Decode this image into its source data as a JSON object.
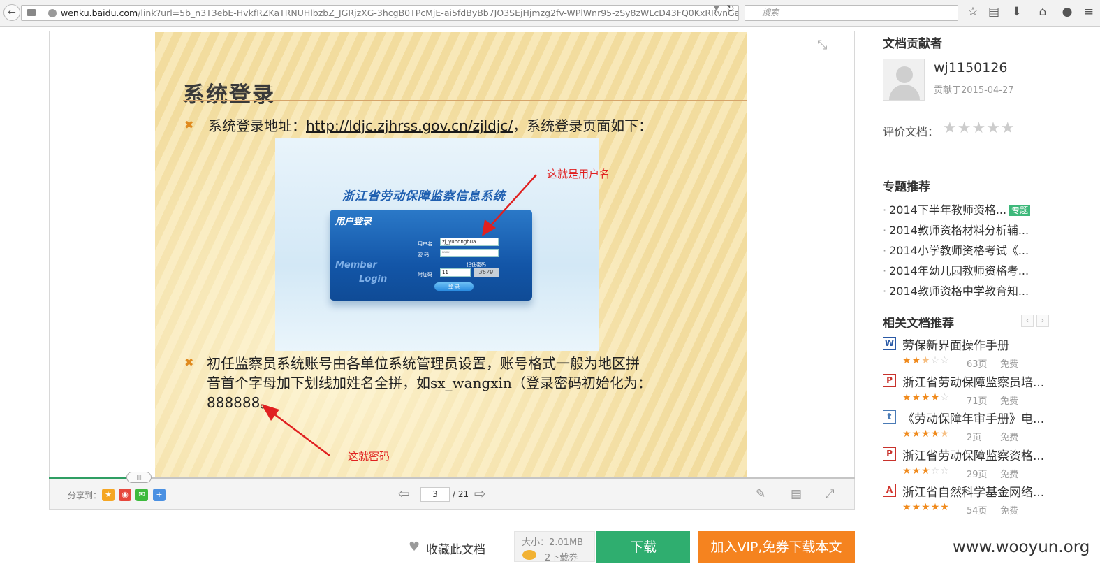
{
  "browser": {
    "url_host": "wenku.baidu.com",
    "url_rest": "/link?url=5b_n3T3ebE-HvkfRZKaTRNUHlbzbZ_JGRjzXG-3hcgB0TPcMjE-ai5fdByBb7JO3SEjHjmzg2fv-WPlWnr95-zSy8zWLcD43FQ0KxRRvnGa",
    "search_placeholder": "搜索",
    "icons": [
      "star-icon",
      "reading-list-icon",
      "download-icon",
      "home-icon",
      "chat-icon"
    ]
  },
  "slide": {
    "title": "系统登录",
    "bullet1_prefix": "系统登录地址：",
    "bullet1_link": "http://ldjc.zjhrss.gov.cn/zjldjc/",
    "bullet1_suffix": "，系统登录页面如下：",
    "bullet2_line1": "初任监察员系统账号由各单位系统管理员设置，账号格式一般为地区拼",
    "bullet2_line2": "音首个字母加下划线加姓名全拼，如sx_wangxin（登录密码初始化为：",
    "bullet2_line3": "888888。",
    "screenshot": {
      "system_title": "浙江省劳动保障监察信息系统",
      "login_header": "用户登录",
      "member": "Member",
      "login": "Login",
      "user_label": "用户名",
      "user_value": "zj_yuhonghua",
      "pwd_label": "密  码",
      "pwd_value": "***",
      "remember": "记住密码",
      "code_label": "附加码",
      "code_value": "11",
      "captcha": "3679",
      "login_button": "登 录"
    },
    "annotation_user": "这就是用户名",
    "annotation_pwd": "这就密码"
  },
  "viewer": {
    "share_label": "分享到：",
    "current_page": "3",
    "total_pages": "/ 21",
    "progress_fraction": 0.11
  },
  "sidebar": {
    "contributor_heading": "文档贡献者",
    "username": "wj1150126",
    "contributed": "贡献于2015-04-27",
    "rate_label": "评价文档：",
    "topics_heading": "专题推荐",
    "topics": [
      {
        "title": "2014下半年教师资格...",
        "badge": "专题"
      },
      {
        "title": "2014教师资格材料分析辅..."
      },
      {
        "title": "2014小学教师资格考试《..."
      },
      {
        "title": "2014年幼儿园教师资格考..."
      },
      {
        "title": "2014教师资格中学教育知..."
      }
    ],
    "related_heading": "相关文档推荐",
    "related": [
      {
        "icon": "W",
        "icon_name": "word-doc-icon",
        "color": "#2b5aa6",
        "title": "劳保新界面操作手册",
        "stars": 2.5,
        "pages": "63页",
        "price": "免费"
      },
      {
        "icon": "P",
        "icon_name": "ppt-doc-icon",
        "color": "#c8322c",
        "title": "浙江省劳动保障监察员培...",
        "stars": 4,
        "pages": "71页",
        "price": "免费"
      },
      {
        "icon": "t",
        "icon_name": "txt-doc-icon",
        "color": "#4a7bb6",
        "title": "《劳动保障年审手册》电...",
        "stars": 4.5,
        "pages": "2页",
        "price": "免费"
      },
      {
        "icon": "P",
        "icon_name": "ppt-doc-icon",
        "color": "#c8322c",
        "title": "浙江省劳动保障监察资格...",
        "stars": 3,
        "pages": "29页",
        "price": "免费"
      },
      {
        "icon": "A",
        "icon_name": "pdf-doc-icon",
        "color": "#d0322a",
        "title": "浙江省自然科学基金网络...",
        "stars": 5,
        "pages": "54页",
        "price": "免费"
      }
    ]
  },
  "actions": {
    "favorite": "收藏此文档",
    "size": "大小：2.01MB",
    "coupons": "2下载券",
    "download": "下载",
    "vip": "加入VIP,免券下载本文"
  },
  "watermark": "www.wooyun.org",
  "colors": {
    "download_green": "#2fae6f",
    "vip_orange": "#f5831f",
    "annotation_red": "#e02020",
    "progress_green": "#2f9e63"
  }
}
